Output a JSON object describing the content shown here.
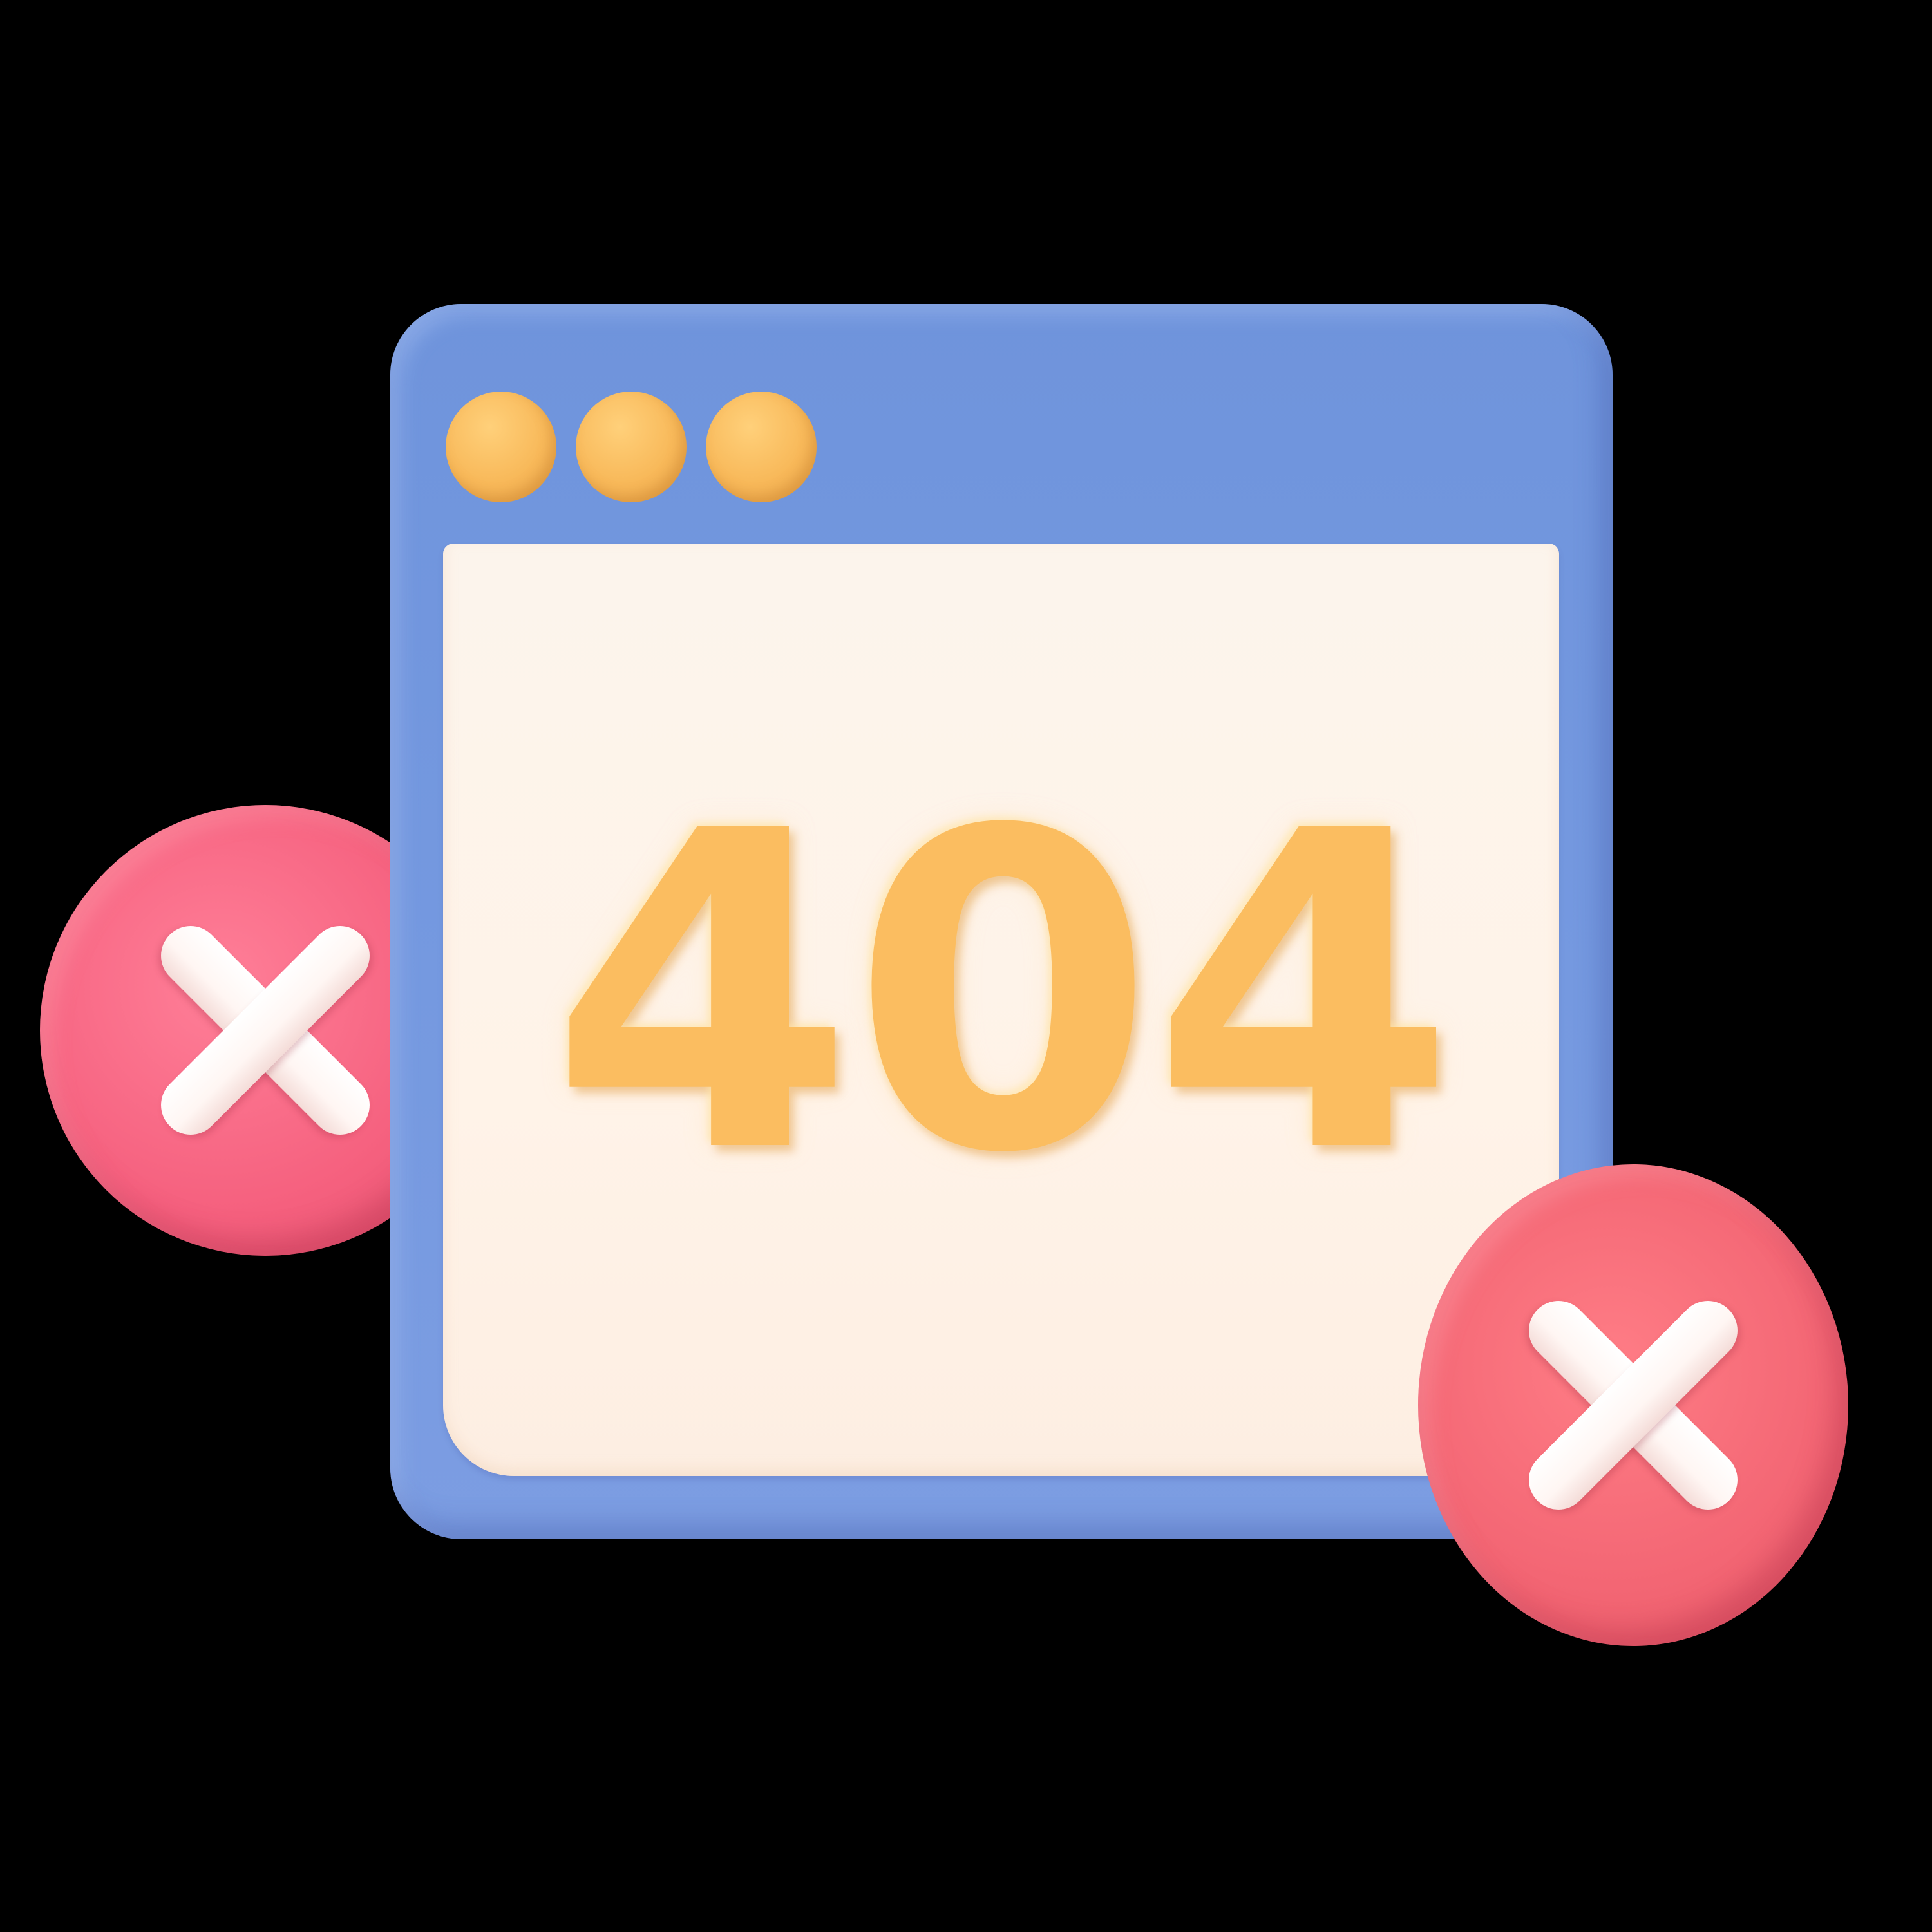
{
  "illustration": {
    "error_code": "404",
    "window_dot_icons": [
      "dot-icon",
      "dot-icon",
      "dot-icon"
    ],
    "badge_icons": [
      "close-icon",
      "close-icon"
    ]
  },
  "colors": {
    "background": "#000000",
    "window_frame": "#7599e0",
    "content_panel": "#fff3e8",
    "error_code_text": "#fbbd60",
    "window_dots": "#f8b95a",
    "badge": "#f36674",
    "badge_mark": "#ffffff"
  }
}
